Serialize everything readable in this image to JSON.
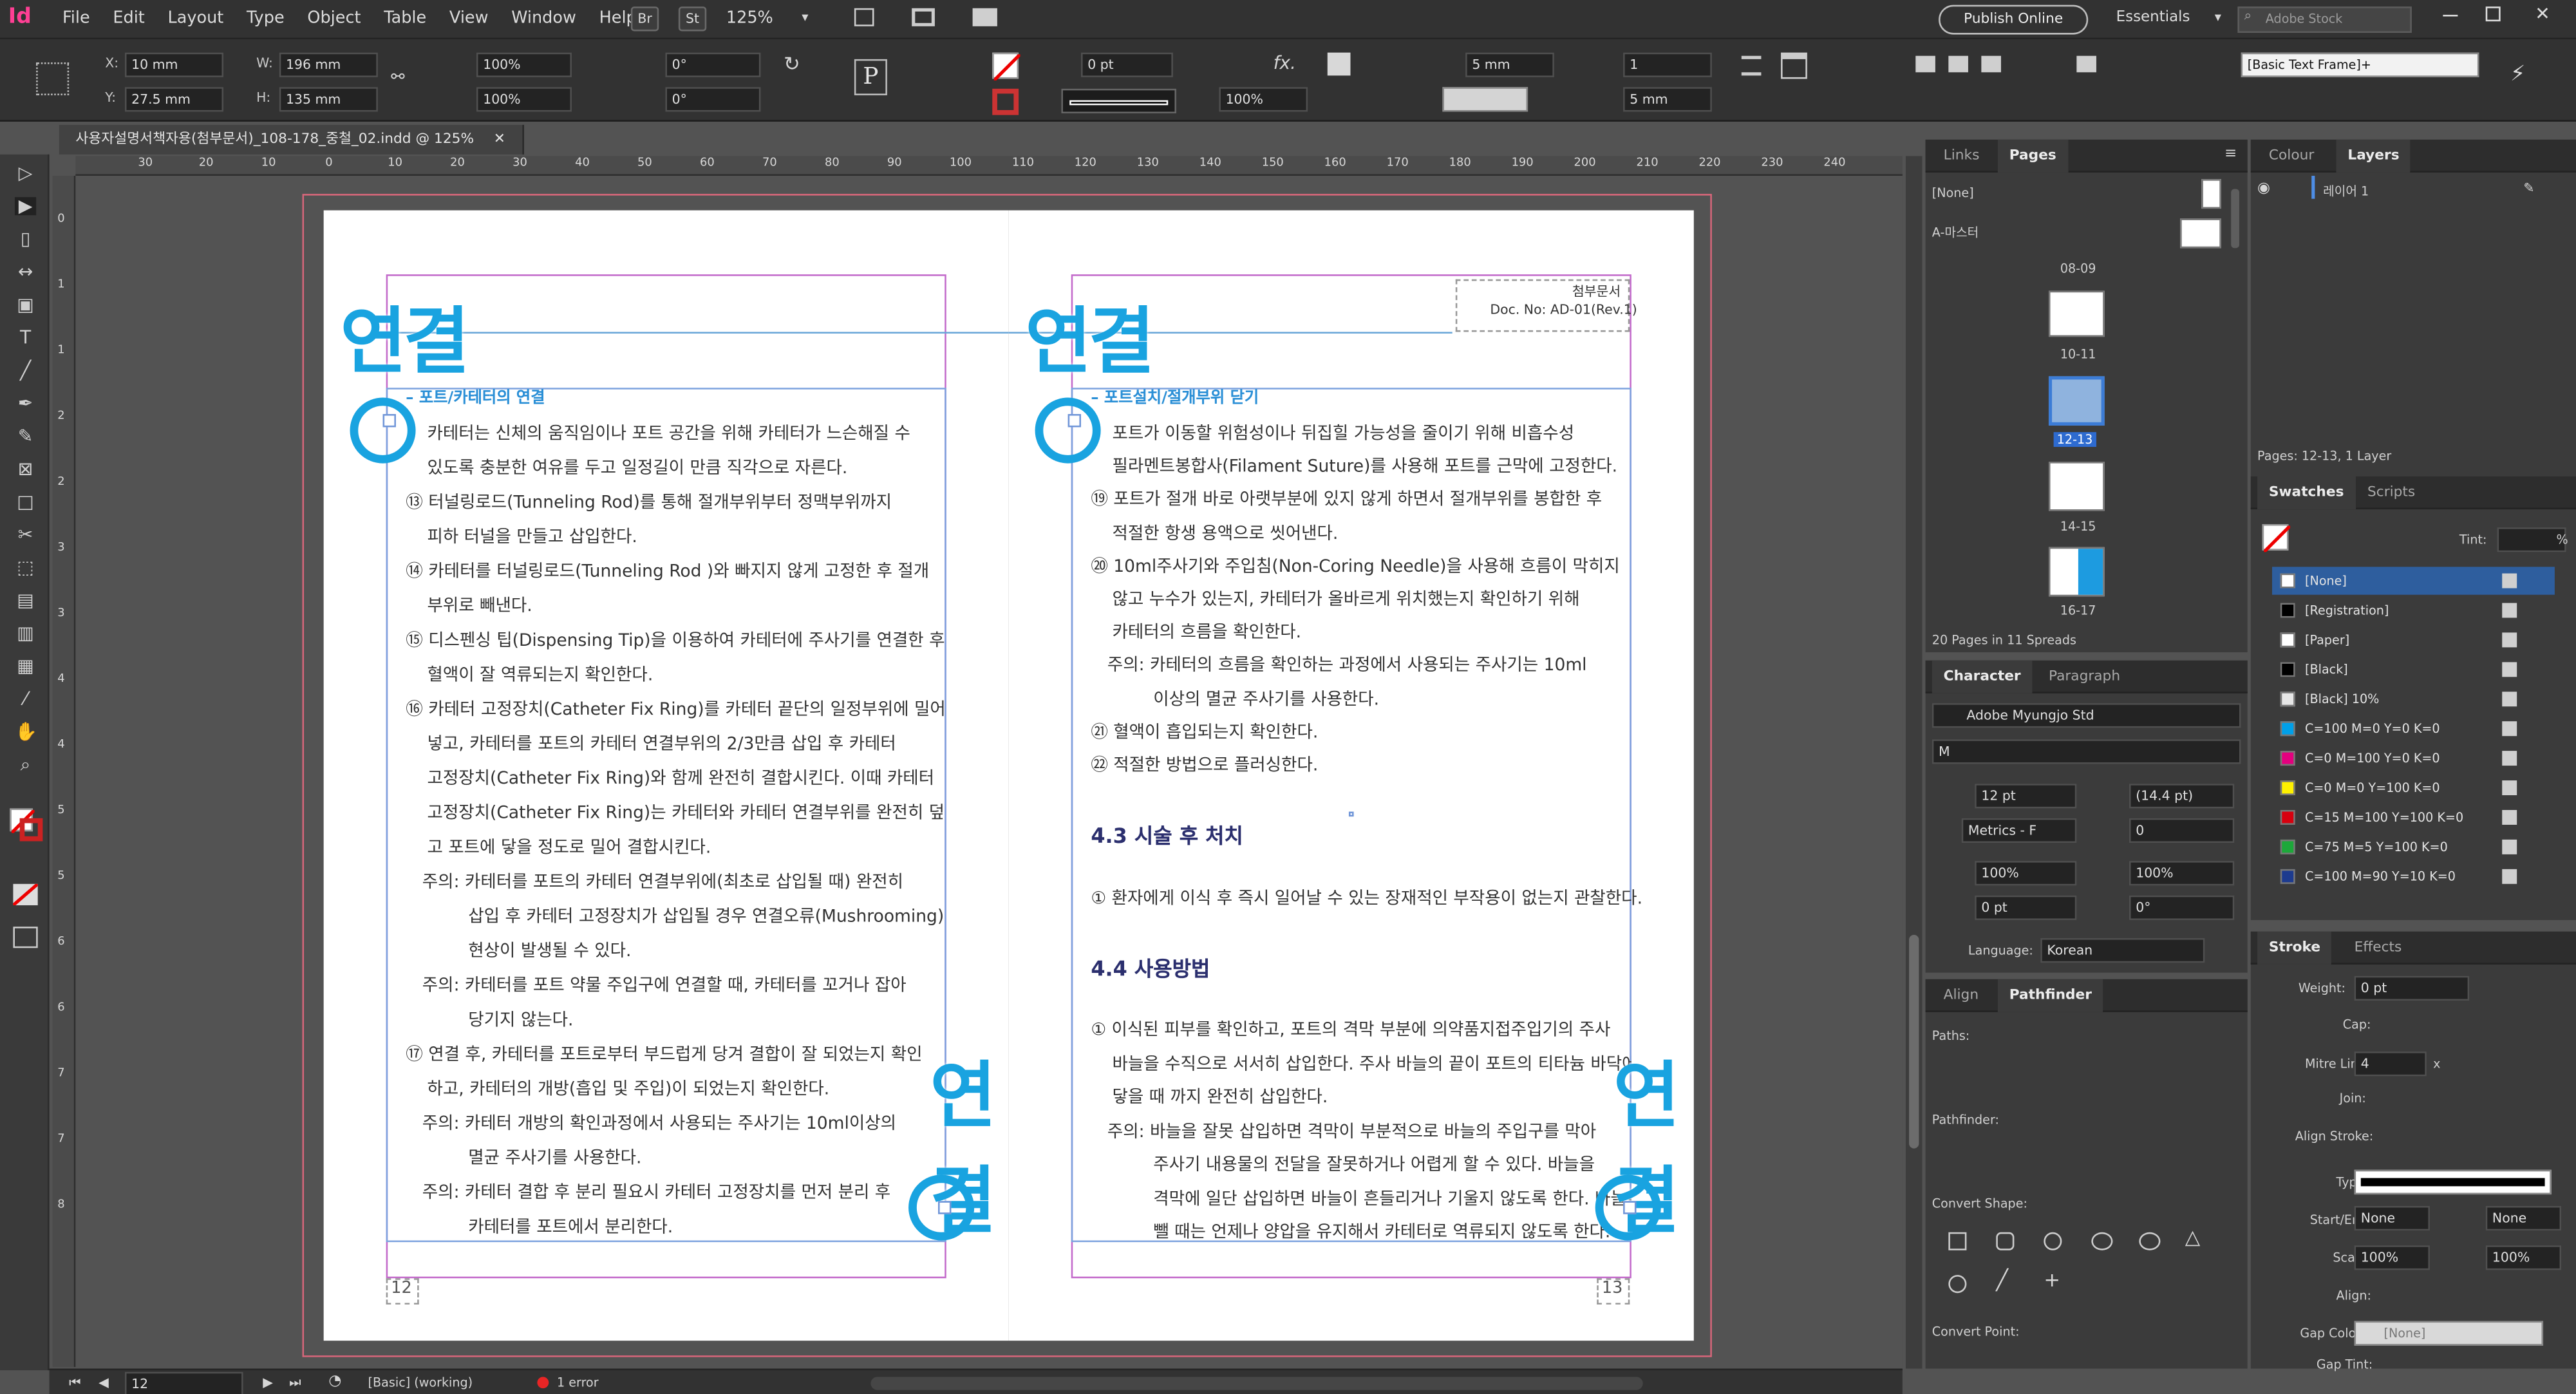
{
  "app": {
    "logo": "Id",
    "menus": [
      "File",
      "Edit",
      "Layout",
      "Type",
      "Object",
      "Table",
      "View",
      "Window",
      "Help"
    ],
    "br": "Br",
    "st": "St",
    "zoom": "125%",
    "publish": "Publish Online",
    "workspace": "Essentials",
    "search_placeholder": "Adobe Stock"
  },
  "control": {
    "x": "10 mm",
    "y": "27.5 mm",
    "w": "196 mm",
    "h": "135 mm",
    "scale_x": "100%",
    "scale_y": "100%",
    "rot": "0°",
    "shear": "0°",
    "stroke_weight": "0 pt",
    "opacity": "100%",
    "gutter": "5 mm",
    "cols": "1",
    "gutter2": "5 mm",
    "frame_style": "[Basic Text Frame]+"
  },
  "doc_tab": "사용자설명서책자용(첨부문서)_108-178_중철_02.indd @ 125%",
  "ruler_h": [
    "0",
    "30",
    "20",
    "10",
    "0",
    "10",
    "20",
    "30",
    "40",
    "50",
    "60",
    "70",
    "80",
    "90",
    "100",
    "110",
    "120",
    "130",
    "140",
    "150",
    "160",
    "170",
    "180",
    "190",
    "200",
    "210",
    "220",
    "230",
    "240"
  ],
  "ruler_v": [
    "0",
    "1",
    "1",
    "2",
    "2",
    "3",
    "3",
    "4",
    "4",
    "5",
    "5",
    "6",
    "6",
    "7",
    "7",
    "8"
  ],
  "left_page": {
    "big_a": "연결",
    "big_b": "연결",
    "subhead": "– 포트/카테터의 연결",
    "page_no": "12",
    "lines": [
      "카테터는 신체의 움직임이나 포트 공간을 위해 카테터가 느슨해질 수",
      "있도록 충분한 여유를 두고 일정길이 만큼 직각으로 자른다.",
      "⑬ 터널링로드(Tunneling Rod)를 통해 절개부위부터 정맥부위까지",
      "피하 터널을 만들고 삽입한다.",
      "⑭ 카테터를 터널링로드(Tunneling Rod )와 빠지지 않게 고정한 후 절개",
      "부위로 빼낸다.",
      "⑮ 디스펜싱 팁(Dispensing Tip)을 이용하여 카테터에 주사기를 연결한 후",
      "혈액이 잘 역류되는지 확인한다.",
      "⑯ 카테터 고정장치(Catheter Fix Ring)를 카테터 끝단의 일정부위에 밀어",
      "넣고, 카테터를 포트의 카테터 연결부위의 2/3만큼 삽입 후 카테터",
      "고정장치(Catheter Fix Ring)와 함께 완전히 결합시킨다. 이때 카테터",
      "고정장치(Catheter Fix Ring)는 카테터와 카테터 연결부위를 완전히 덮",
      "고 포트에 닿을 정도로 밀어 결합시킨다.",
      "주의: 카테터를 포트의 카테터 연결부위에(최초로 삽입될 때) 완전히",
      "삽입 후 카테터 고정장치가 삽입될 경우 연결오류(Mushrooming)",
      "현상이 발생될 수 있다.",
      "주의: 카테터를 포트 약물 주입구에 연결할 때, 카테터를 꼬거나 잡아",
      "당기지 않는다.",
      "⑰ 연결 후, 카테터를 포트로부터 부드럽게 당겨 결합이 잘 되었는지 확인",
      "하고, 카테터의 개방(흡입 및 주입)이 되었는지 확인한다.",
      "주의: 카테터 개방의 확인과정에서 사용되는 주사기는 10ml이상의",
      "멸균 주사기를 사용한다.",
      "주의: 카테터 결합 후 분리 필요시 카테터 고정장치를 먼저 분리 후",
      "카테터를 포트에서 분리한다."
    ]
  },
  "right_page": {
    "big_a": "연결",
    "big_b": "연결",
    "doc_label": "첨부문서",
    "doc_no": "Doc. No: AD-01(Rev.1)",
    "subhead": "– 포트설치/절개부위 닫기",
    "page_no": "13",
    "lines": [
      "포트가 이동할 위험성이나 뒤집힐 가능성을 줄이기 위해 비흡수성",
      "필라멘트봉합사(Filament Suture)를 사용해 포트를 근막에 고정한다.",
      "⑲ 포트가 절개 바로 아랫부분에 있지 않게 하면서 절개부위를 봉합한 후",
      "적절한 항생 용액으로 씻어낸다.",
      "⑳ 10ml주사기와 주입침(Non-Coring Needle)을 사용해 흐름이 막히지",
      "않고 누수가 있는지, 카테터가 올바르게 위치했는지 확인하기 위해",
      "카테터의 흐름을 확인한다.",
      "주의: 카테터의 흐름을 확인하는 과정에서 사용되는 주사기는 10ml",
      "이상의 멸균 주사기를 사용한다.",
      "㉑ 혈액이 흡입되는지 확인한다.",
      "㉒ 적절한 방법으로 플러싱한다."
    ],
    "h43": "4.3 시술 후 처치",
    "p43": "① 환자에게 이식 후 즉시 일어날 수 있는 장재적인 부작용이 없는지 관찰한다.",
    "h44": "4.4 사용방법",
    "lines44": [
      "① 이식된 피부를 확인하고, 포트의 격막 부분에 의약품지접주입기의 주사",
      "바늘을 수직으로 서서히 삽입한다. 주사 바늘의 끝이 포트의 티타늄 바닥에",
      "닿을 때 까지 완전히 삽입한다.",
      "주의: 바늘을 잘못 삽입하면 격막이 부분적으로 바늘의 주입구를 막아",
      "주사기 내용물의 전달을 잘못하거나 어렵게 할 수 있다. 바늘을",
      "격막에 일단 삽입하면 바늘이 흔들리거나 기울지 않도록 한다. 바늘을",
      "뺄 때는 언제나 양압을 유지해서 카테터로 역류되지 않도록 한다."
    ]
  },
  "status": {
    "page": "12",
    "style": "[Basic] (working)",
    "errors": "1 error"
  },
  "pages_panel": {
    "tabs": [
      "Links",
      "Pages"
    ],
    "none": "[None]",
    "master": "A-마스터",
    "spreads": [
      "08-09",
      "10-11",
      "12-13",
      "14-15",
      "16-17"
    ],
    "summary": "20 Pages in 11 Spreads"
  },
  "layers_panel": {
    "tabs": [
      "Colour",
      "Layers"
    ],
    "layer": "레이어 1",
    "summary": "Pages: 12-13, 1 Layer"
  },
  "swatches_panel": {
    "tabs": [
      "Swatches",
      "Scripts"
    ],
    "tint": "Tint:",
    "pct": "%",
    "items": [
      {
        "name": "[None]",
        "color": "#ffffff"
      },
      {
        "name": "[Registration]",
        "color": "#000000"
      },
      {
        "name": "[Paper]",
        "color": "#ffffff"
      },
      {
        "name": "[Black]",
        "color": "#000000"
      },
      {
        "name": "[Black] 10%",
        "color": "#e6e6e6"
      },
      {
        "name": "C=100 M=0 Y=0 K=0",
        "color": "#00a0e9"
      },
      {
        "name": "C=0 M=100 Y=0 K=0",
        "color": "#e4007f"
      },
      {
        "name": "C=0 M=0 Y=100 K=0",
        "color": "#fff100"
      },
      {
        "name": "C=15 M=100 Y=100 K=0",
        "color": "#d7000f"
      },
      {
        "name": "C=75 M=5 Y=100 K=0",
        "color": "#1da83a"
      },
      {
        "name": "C=100 M=90 Y=10 K=0",
        "color": "#1d3b8f"
      }
    ]
  },
  "character_panel": {
    "tabs": [
      "Character",
      "Paragraph"
    ],
    "font": "Adobe Myungjo Std",
    "style": "M",
    "size": "12 pt",
    "leading": "(14.4 pt)",
    "kerning": "Metrics - F",
    "tracking": "0",
    "vscale": "100%",
    "hscale": "100%",
    "baseline": "0 pt",
    "skew": "0°",
    "language_label": "Language:",
    "language": "Korean"
  },
  "pathfinder_panel": {
    "tabs": [
      "Align",
      "Pathfinder"
    ],
    "paths": "Paths:",
    "pathfinder": "Pathfinder:",
    "shape": "Convert Shape:",
    "point": "Convert Point:"
  },
  "stroke_panel": {
    "tabs": [
      "Stroke",
      "Effects"
    ],
    "weight_label": "Weight:",
    "weight": "0 pt",
    "cap": "Cap:",
    "miter_label": "Mitre Limit:",
    "miter": "4",
    "x": "x",
    "join": "Join:",
    "align_stroke": "Align Stroke:",
    "type": "Type:",
    "startend": "Start/End:",
    "start": "None",
    "end": "None",
    "scale": "Scale:",
    "scale1": "100%",
    "scale2": "100%",
    "align": "Align:",
    "gap_colour": "Gap Colour:",
    "gap_value": "[None]",
    "gap_tint": "Gap Tint:"
  }
}
